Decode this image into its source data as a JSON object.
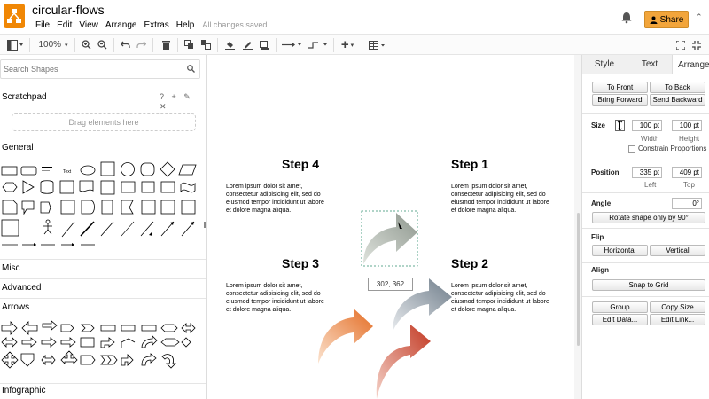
{
  "app": {
    "document_title": "circular-flows",
    "menu": [
      "File",
      "Edit",
      "View",
      "Arrange",
      "Extras",
      "Help"
    ],
    "status": "All changes saved",
    "share_label": "Share"
  },
  "toolbar": {
    "zoom": "100%"
  },
  "sidebar": {
    "search_placeholder": "Search Shapes",
    "scratchpad_title": "Scratchpad",
    "scratchpad_icons": "? + ✎ ✕",
    "drag_hint": "Drag elements here",
    "sections": [
      "General",
      "Misc",
      "Advanced",
      "Arrows",
      "Infographic"
    ]
  },
  "canvas": {
    "steps": [
      {
        "title": "Step 4",
        "body": "Lorem ipsum dolor sit amet, consectetur adipisicing elit, sed do eiusmod tempor incididunt ut labore et dolore magna aliqua."
      },
      {
        "title": "Step 1",
        "body": "Lorem ipsum dolor sit amet, consectetur adipisicing elit, sed do eiusmod tempor incididunt ut labore et dolore magna aliqua."
      },
      {
        "title": "Step 3",
        "body": "Lorem ipsum dolor sit amet, consectetur adipisicing elit, sed do eiusmod tempor incididunt ut labore et dolore magna aliqua."
      },
      {
        "title": "Step 2",
        "body": "Lorem ipsum dolor sit amet, consectetur adipisicing elit, sed do eiusmod tempor incididunt ut labore et dolore magna aliqua."
      }
    ],
    "coordinates": "302, 362",
    "arrow_colors": {
      "gray_green": "#9aa39a",
      "slate": "#7d8a96",
      "orange": "#e8782f",
      "red": "#c8412f"
    }
  },
  "panel": {
    "tabs": [
      "Style",
      "Text",
      "Arrange"
    ],
    "active_tab": "Arrange",
    "to_front": "To Front",
    "to_back": "To Back",
    "bring_forward": "Bring Forward",
    "send_backward": "Send Backward",
    "size_label": "Size",
    "width_value": "100 pt",
    "height_value": "100 pt",
    "width_label": "Width",
    "height_label": "Height",
    "constrain": "Constrain Proportions",
    "position_label": "Position",
    "left_value": "335 pt",
    "top_value": "409 pt",
    "left_label": "Left",
    "top_label": "Top",
    "angle_label": "Angle",
    "angle_value": "0°",
    "rotate_label": "Rotate shape only by 90°",
    "flip_label": "Flip",
    "horizontal": "Horizontal",
    "vertical": "Vertical",
    "align_label": "Align",
    "snap_to_grid": "Snap to Grid",
    "group": "Group",
    "copy_size": "Copy Size",
    "edit_data": "Edit Data...",
    "edit_link": "Edit Link..."
  },
  "accent_color": "#f08705"
}
